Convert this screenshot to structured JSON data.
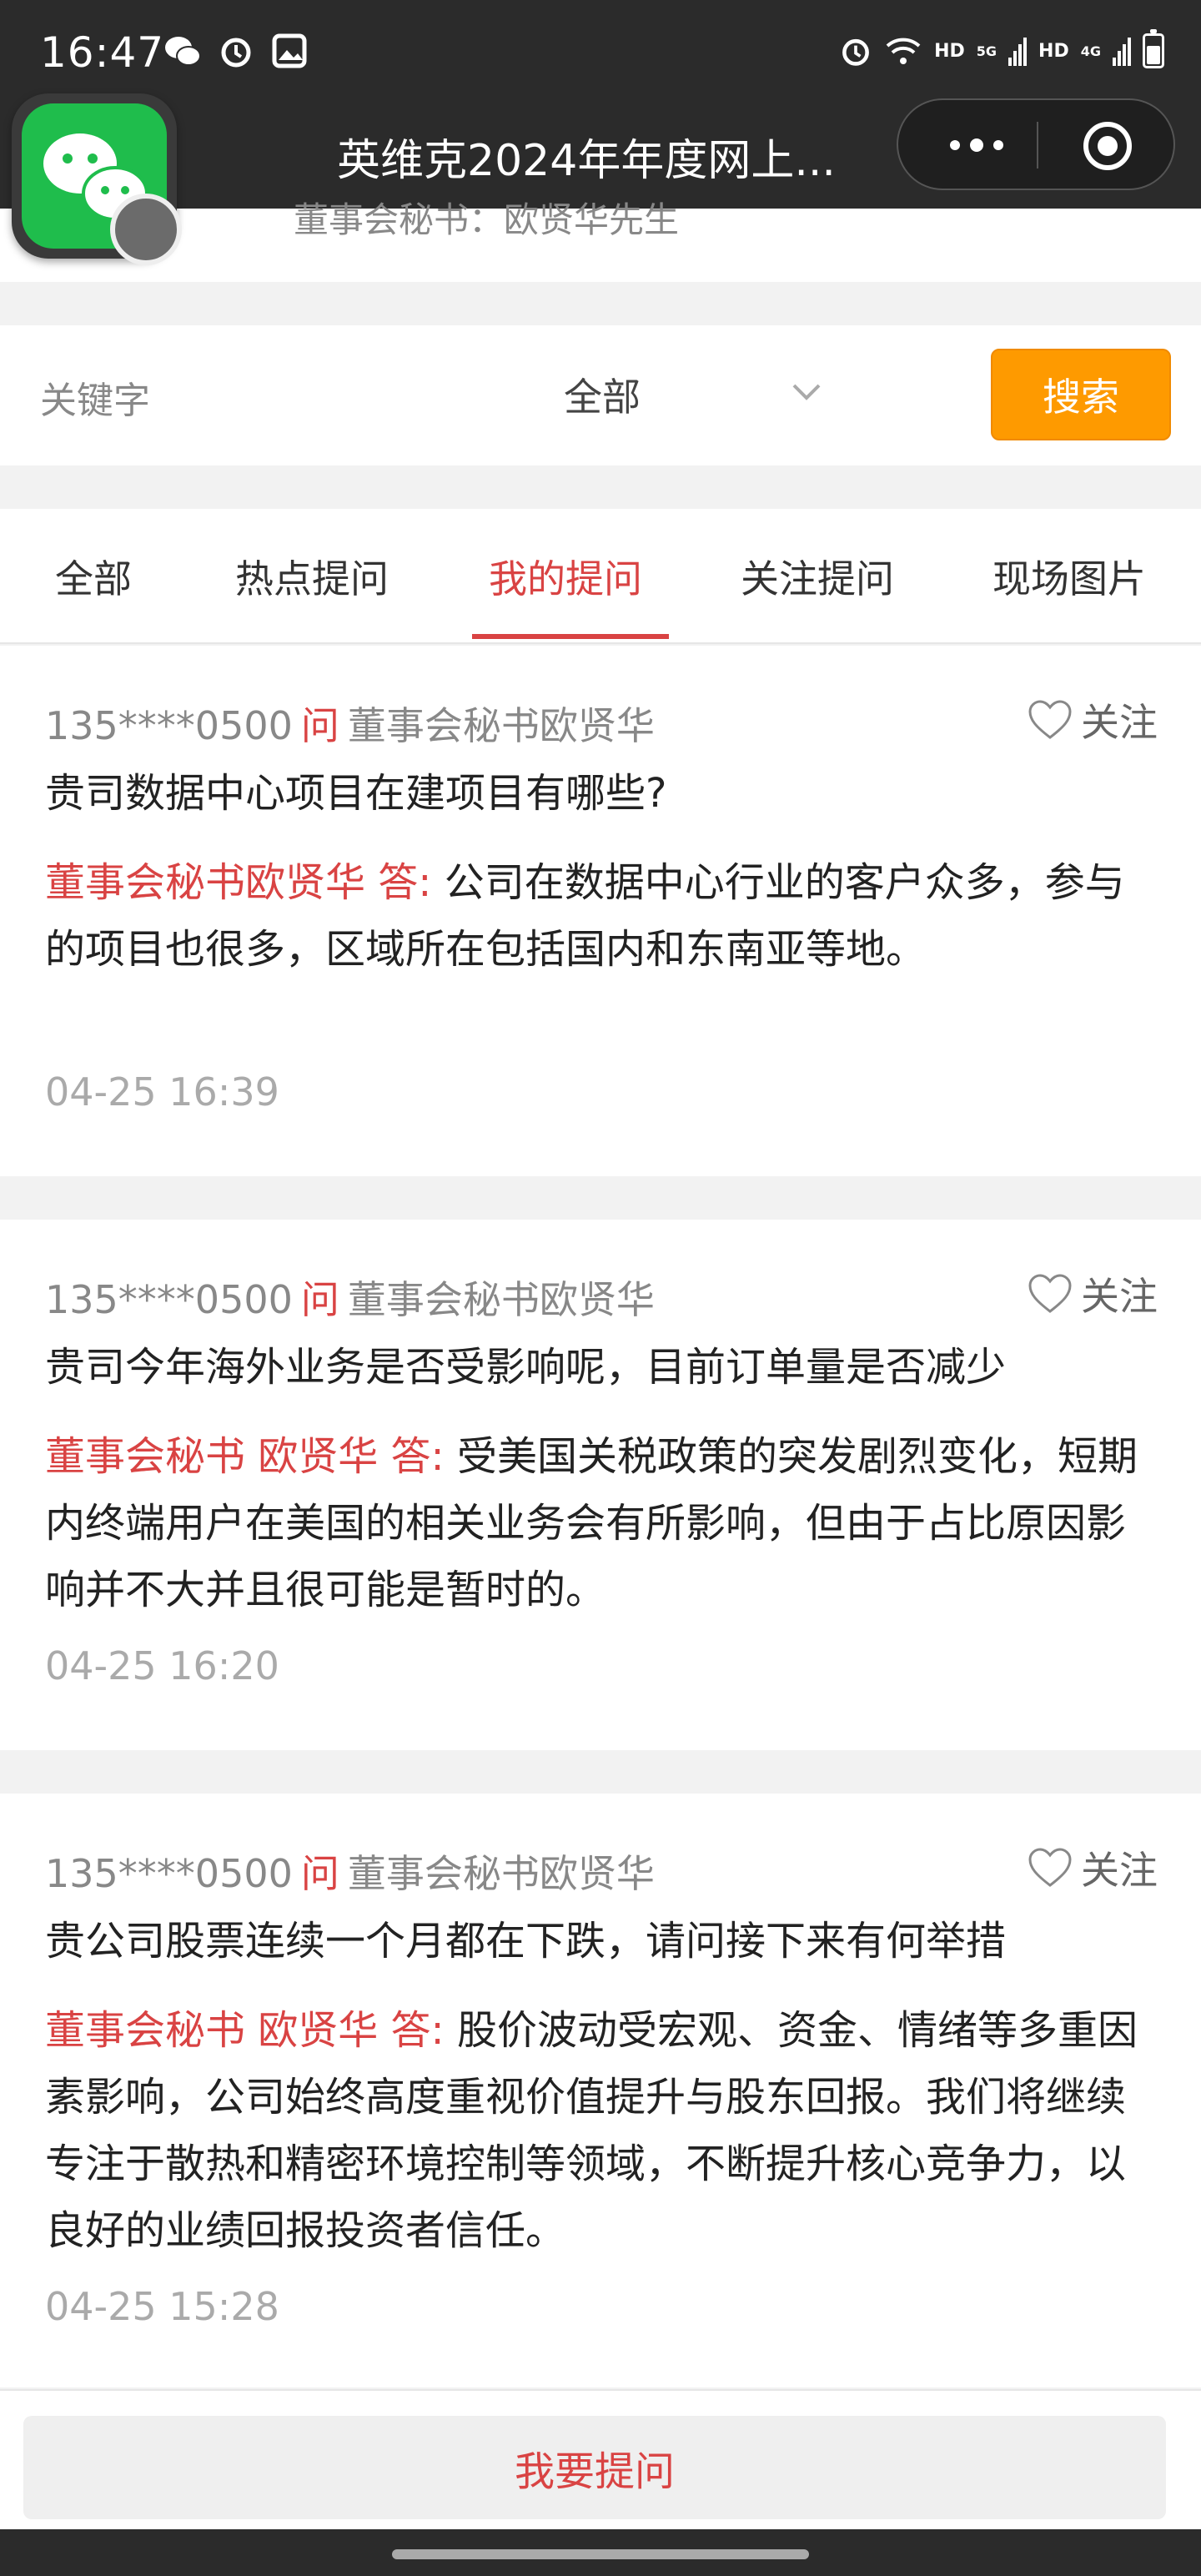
{
  "status_bar": {
    "time": "16:47",
    "right_labels": [
      "HD",
      "5G",
      "HD",
      "4G"
    ]
  },
  "app": {
    "title": "英维克2024年年度网上..."
  },
  "top_card": {
    "partial_text": "董事会秘书：欧贤华先生"
  },
  "search": {
    "keyword_placeholder": "关键字",
    "category_selected": "全部",
    "search_button": "搜索"
  },
  "tabs": [
    {
      "label": "全部",
      "active": false
    },
    {
      "label": "热点提问",
      "active": false
    },
    {
      "label": "我的提问",
      "active": true
    },
    {
      "label": "关注提问",
      "active": false
    },
    {
      "label": "现场图片",
      "active": false
    }
  ],
  "qa_items": [
    {
      "user": "135****0500",
      "ask_marker": "问",
      "to": "董事会秘书欧贤华",
      "follow_label": "关注",
      "question": "贵司数据中心项目在建项目有哪些?",
      "answerer": "董事会秘书欧贤华 答:",
      "answer": "公司在数据中心行业的客户众多，参与的项目也很多，区域所在包括国内和东南亚等地。",
      "time": "04-25 16:39"
    },
    {
      "user": "135****0500",
      "ask_marker": "问",
      "to": "董事会秘书欧贤华",
      "follow_label": "关注",
      "question": "贵司今年海外业务是否受影响呢，目前订单量是否减少",
      "answerer": "董事会秘书 欧贤华 答:",
      "answer": "受美国关税政策的突发剧烈变化，短期内终端用户在美国的相关业务会有所影响，但由于占比原因影响并不大并且很可能是暂时的。",
      "time": "04-25 16:20"
    },
    {
      "user": "135****0500",
      "ask_marker": "问",
      "to": "董事会秘书欧贤华",
      "follow_label": "关注",
      "question": "贵公司股票连续一个月都在下跌，请问接下来有何举措",
      "answerer": "董事会秘书 欧贤华 答:",
      "answer": "股价波动受宏观、资金、情绪等多重因素影响，公司始终高度重视价值提升与股东回报。我们将继续专注于散热和精密环境控制等领域，不断提升核心竞争力，以良好的业绩回报投资者信任。",
      "time": "04-25 15:28"
    }
  ],
  "bottom": {
    "ask_button": "我要提问"
  },
  "colors": {
    "accent_red": "#d94343",
    "search_orange": "#fe9a00",
    "dark_bar": "#2b2b2b"
  }
}
